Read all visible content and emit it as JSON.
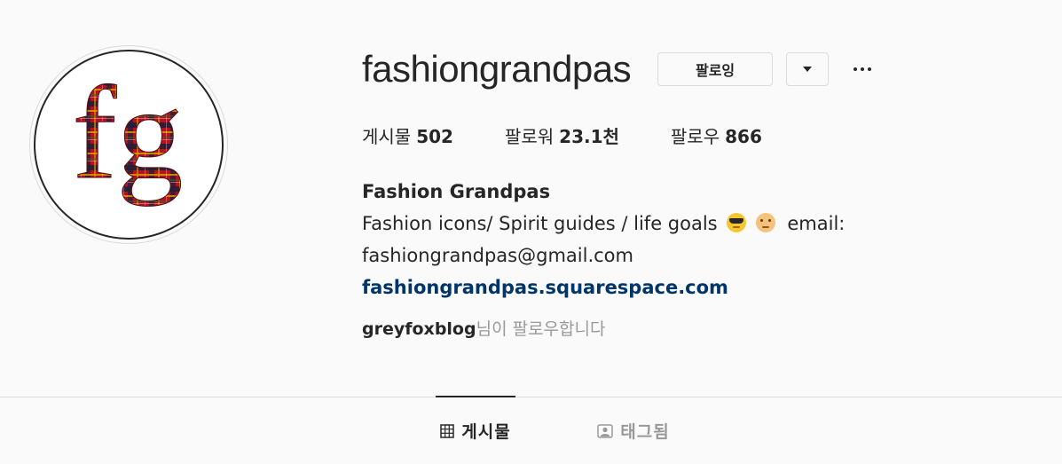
{
  "profile": {
    "username": "fashiongrandpas",
    "follow_button_label": "팔로잉",
    "avatar_monogram": "fg"
  },
  "stats": [
    {
      "label": "게시물",
      "value": "502"
    },
    {
      "label": "팔로워",
      "value": "23.1천"
    },
    {
      "label": "팔로우",
      "value": "866"
    }
  ],
  "bio": {
    "full_name": "Fashion Grandpas",
    "line1": "Fashion icons/ Spirit guides / life goals",
    "emojis": [
      "smiling-face-with-sunglasses-emoji",
      "older-man-emoji"
    ],
    "line1_suffix": "email:",
    "line2": "fashiongrandpas@gmail.com",
    "link": "fashiongrandpas.squarespace.com"
  },
  "followed_by": {
    "name": "greyfoxblog",
    "suffix": "님이 팔로우합니다"
  },
  "tabs": [
    {
      "label": "게시물",
      "icon": "grid-icon",
      "active": true
    },
    {
      "label": "태그됨",
      "icon": "tagged-user-icon",
      "active": false
    }
  ],
  "colors": {
    "background": "#fafafa",
    "text": "#262626",
    "muted": "#999999",
    "link": "#003569",
    "border": "#dbdbdb"
  }
}
